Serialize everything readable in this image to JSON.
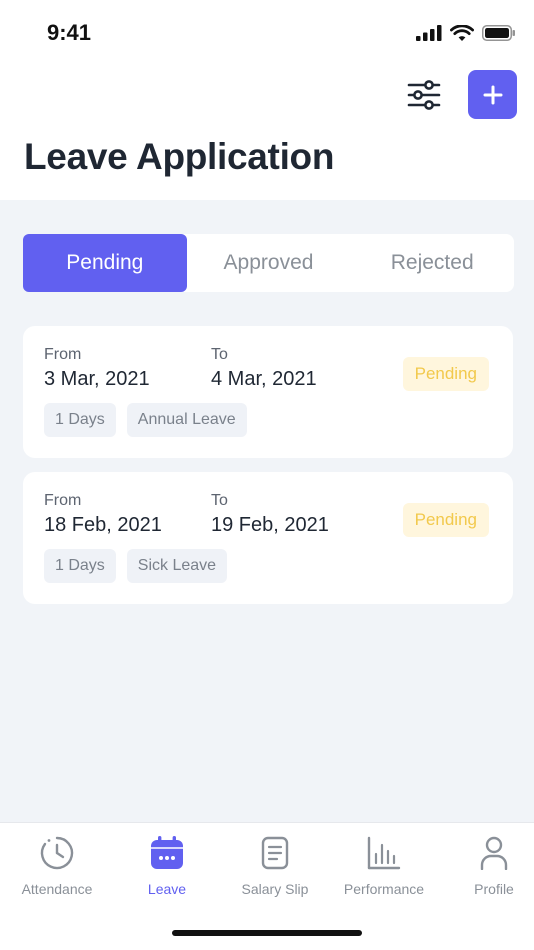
{
  "status_bar": {
    "time": "9:41"
  },
  "header": {
    "title": "Leave Application"
  },
  "tabs": [
    {
      "label": "Pending",
      "active": true
    },
    {
      "label": "Approved",
      "active": false
    },
    {
      "label": "Rejected",
      "active": false
    }
  ],
  "leaves": [
    {
      "from_label": "From",
      "from": "3 Mar, 2021",
      "to_label": "To",
      "to": "4 Mar, 2021",
      "status": "Pending",
      "days": "1 Days",
      "type": "Annual Leave"
    },
    {
      "from_label": "From",
      "from": "18 Feb, 2021",
      "to_label": "To",
      "to": "19 Feb, 2021",
      "status": "Pending",
      "days": "1 Days",
      "type": "Sick Leave"
    }
  ],
  "nav": [
    {
      "label": "Attendance",
      "icon": "clock-icon",
      "active": false
    },
    {
      "label": "Leave",
      "icon": "calendar-icon",
      "active": true
    },
    {
      "label": "Salary Slip",
      "icon": "document-icon",
      "active": false
    },
    {
      "label": "Performance",
      "icon": "bar-chart-icon",
      "active": false
    },
    {
      "label": "Profile",
      "icon": "person-icon",
      "active": false
    }
  ],
  "colors": {
    "accent": "#6160f0",
    "pending_text": "#f2c94c",
    "pending_bg": "#fff6dd",
    "background": "#f1f4f8"
  }
}
